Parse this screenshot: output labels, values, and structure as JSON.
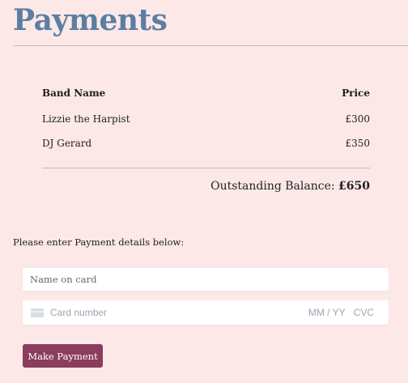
{
  "page": {
    "title": "Payments",
    "accent_color": "#5a7fa3",
    "button_color": "#8a3d5c",
    "background_color": "#fde8e8"
  },
  "table": {
    "headers": {
      "band": "Band Name",
      "price": "Price"
    },
    "rows": [
      {
        "band": "Lizzie the Harpist",
        "price": "£300"
      },
      {
        "band": "DJ Gerard",
        "price": "£350"
      }
    ]
  },
  "balance": {
    "label": "Outstanding Balance:",
    "amount": "£650"
  },
  "payment": {
    "prompt": "Please enter Payment details below:",
    "name_placeholder": "Name on card",
    "card_icon": "credit-card-icon",
    "card_number_placeholder": "Card number",
    "expiry_placeholder": "MM / YY",
    "cvc_placeholder": "CVC",
    "submit_label": "Make Payment"
  }
}
